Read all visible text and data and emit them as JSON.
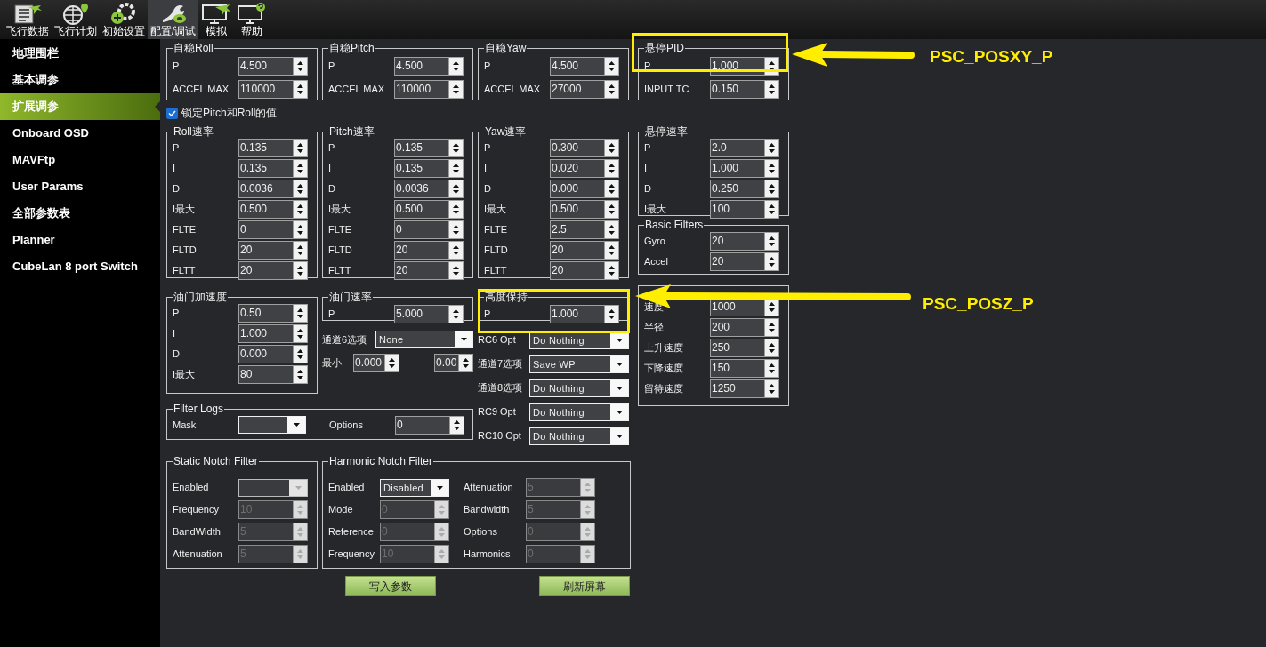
{
  "toolbar": [
    {
      "label": "飞行数据",
      "selected": false
    },
    {
      "label": "飞行计划",
      "selected": false
    },
    {
      "label": "初始设置",
      "selected": false
    },
    {
      "label": "配置/调试",
      "selected": true
    },
    {
      "label": "模拟",
      "selected": false
    },
    {
      "label": "帮助",
      "selected": false
    }
  ],
  "sidebar": [
    {
      "label": "地理围栏",
      "selected": false
    },
    {
      "label": "基本调参",
      "selected": false
    },
    {
      "label": "扩展调参",
      "selected": true
    },
    {
      "label": "Onboard OSD",
      "selected": false
    },
    {
      "label": "MAVFtp",
      "selected": false
    },
    {
      "label": "User Params",
      "selected": false
    },
    {
      "label": "全部参数表",
      "selected": false
    },
    {
      "label": "Planner",
      "selected": false
    },
    {
      "label": "CubeLan 8 port Switch",
      "selected": false
    }
  ],
  "stabilize_groups": [
    {
      "title": "自稳Roll",
      "fields": [
        {
          "label": "P",
          "value": "4.500"
        },
        {
          "label": "ACCEL MAX",
          "value": "110000"
        }
      ]
    },
    {
      "title": "自稳Pitch",
      "fields": [
        {
          "label": "P",
          "value": "4.500"
        },
        {
          "label": "ACCEL MAX",
          "value": "110000"
        }
      ]
    },
    {
      "title": "自稳Yaw",
      "fields": [
        {
          "label": "P",
          "value": "4.500"
        },
        {
          "label": "ACCEL MAX",
          "value": "27000"
        }
      ]
    }
  ],
  "hover_pid": {
    "title": "悬停PID",
    "fields": [
      {
        "label": "P",
        "value": "1.000"
      },
      {
        "label": "INPUT TC",
        "value": "0.150"
      }
    ]
  },
  "lock_checkbox": {
    "label": "锁定Pitch和Roll的值",
    "checked": true
  },
  "rate_groups": [
    {
      "title": "Roll速率",
      "fields": [
        {
          "label": "P",
          "value": "0.135"
        },
        {
          "label": "I",
          "value": "0.135"
        },
        {
          "label": "D",
          "value": "0.0036"
        },
        {
          "label": "I最大",
          "value": "0.500"
        },
        {
          "label": "FLTE",
          "value": "0"
        },
        {
          "label": "FLTD",
          "value": "20"
        },
        {
          "label": "FLTT",
          "value": "20"
        }
      ]
    },
    {
      "title": "Pitch速率",
      "fields": [
        {
          "label": "P",
          "value": "0.135"
        },
        {
          "label": "I",
          "value": "0.135"
        },
        {
          "label": "D",
          "value": "0.0036"
        },
        {
          "label": "I最大",
          "value": "0.500"
        },
        {
          "label": "FLTE",
          "value": "0"
        },
        {
          "label": "FLTD",
          "value": "20"
        },
        {
          "label": "FLTT",
          "value": "20"
        }
      ]
    },
    {
      "title": "Yaw速率",
      "fields": [
        {
          "label": "P",
          "value": "0.300"
        },
        {
          "label": "I",
          "value": "0.020"
        },
        {
          "label": "D",
          "value": "0.000"
        },
        {
          "label": "I最大",
          "value": "0.500"
        },
        {
          "label": "FLTE",
          "value": "2.5"
        },
        {
          "label": "FLTD",
          "value": "20"
        },
        {
          "label": "FLTT",
          "value": "20"
        }
      ]
    }
  ],
  "hover_rate": {
    "title": "悬停速率",
    "fields": [
      {
        "label": "P",
        "value": "2.0"
      },
      {
        "label": "I",
        "value": "1.000"
      },
      {
        "label": "D",
        "value": "0.250"
      },
      {
        "label": "I最大",
        "value": "100"
      }
    ]
  },
  "basic_filters": {
    "title": "Basic Filters",
    "fields": [
      {
        "label": "Gyro",
        "value": "20"
      },
      {
        "label": "Accel",
        "value": "20"
      }
    ]
  },
  "throttle_accel": {
    "title": "油门加速度",
    "fields": [
      {
        "label": "P",
        "value": "0.50"
      },
      {
        "label": "I",
        "value": "1.000"
      },
      {
        "label": "D",
        "value": "0.000"
      },
      {
        "label": "I最大",
        "value": "80"
      }
    ]
  },
  "throttle_rate": {
    "title": "油门速率",
    "fields": [
      {
        "label": "P",
        "value": "5.000"
      }
    ]
  },
  "channel6": {
    "label": "通道6选项",
    "value": "None"
  },
  "min_row": {
    "label": "最小",
    "values": [
      "0.000",
      "0.00"
    ]
  },
  "altitude_hold": {
    "title": "高度保持",
    "fields": [
      {
        "label": "P",
        "value": "1.000"
      }
    ]
  },
  "rc_options": [
    {
      "label": "RC6 Opt",
      "value": "Do Nothing"
    },
    {
      "label": "通道7选项",
      "value": "Save WP"
    },
    {
      "label": "通道8选项",
      "value": "Do Nothing"
    },
    {
      "label": "RC9 Opt",
      "value": "Do Nothing"
    },
    {
      "label": "RC10 Opt",
      "value": "Do Nothing"
    }
  ],
  "nav_group": {
    "fields": [
      {
        "label": "速度",
        "value": "1000"
      },
      {
        "label": "半径",
        "value": "200"
      },
      {
        "label": "上升速度",
        "value": "250"
      },
      {
        "label": "下降速度",
        "value": "150"
      },
      {
        "label": "留待速度",
        "value": "1250"
      }
    ]
  },
  "filter_logs": {
    "title": "Filter Logs",
    "mask": {
      "label": "Mask"
    },
    "options": {
      "label": "Options",
      "value": "0"
    }
  },
  "static_notch": {
    "title": "Static Notch Filter",
    "enabled": {
      "label": "Enabled",
      "disabled": true
    },
    "fields": [
      {
        "label": "Frequency",
        "value": "10",
        "disabled": true
      },
      {
        "label": "BandWidth",
        "value": "5",
        "disabled": true
      },
      {
        "label": "Attenuation",
        "value": "5",
        "disabled": true
      }
    ]
  },
  "harmonic_notch": {
    "title": "Harmonic Notch Filter",
    "enabled": {
      "label": "Enabled",
      "value": "Disabled",
      "disabled": false
    },
    "fields_left": [
      {
        "label": "Mode",
        "value": "0",
        "disabled": true
      },
      {
        "label": "Reference",
        "value": "0",
        "disabled": true
      },
      {
        "label": "Frequency",
        "value": "10",
        "disabled": true
      }
    ],
    "fields_right": [
      {
        "label": "Attenuation",
        "value": "5",
        "disabled": true
      },
      {
        "label": "Bandwidth",
        "value": "5",
        "disabled": true
      },
      {
        "label": "Options",
        "value": "0",
        "disabled": true
      },
      {
        "label": "Harmonics",
        "value": "0",
        "disabled": true
      }
    ]
  },
  "buttons": [
    "写入参数",
    "刷新屏幕"
  ],
  "annotations": [
    {
      "label": "PSC_POSXY_P"
    },
    {
      "label": "PSC_POSZ_P"
    }
  ]
}
